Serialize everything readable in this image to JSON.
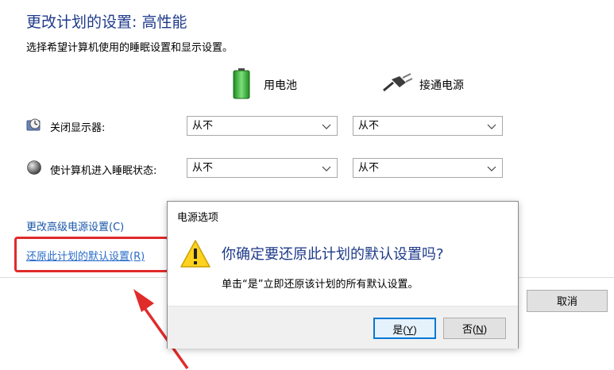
{
  "header": {
    "title": "更改计划的设置: 高性能",
    "subtitle": "选择希望计算机使用的睡眠设置和显示设置。"
  },
  "columns": {
    "battery": "用电池",
    "plugged_in": "接通电源"
  },
  "settings": [
    {
      "label": "关闭显示器:",
      "battery_value": "从不",
      "plugged_value": "从不",
      "icon": "monitor-clock-icon"
    },
    {
      "label": "使计算机进入睡眠状态:",
      "battery_value": "从不",
      "plugged_value": "从不",
      "icon": "moon-sleep-icon"
    }
  ],
  "links": {
    "advanced": "更改高级电源设置(C)",
    "restore": "还原此计划的默认设置(R)"
  },
  "buttons": {
    "cancel": "取消"
  },
  "dialog": {
    "title": "电源选项",
    "heading": "你确定要还原此计划的默认设置吗?",
    "message": "单击“是”立即还原该计划的所有默认设置。",
    "yes_label": "是(",
    "yes_key": "Y",
    "yes_suffix": ")",
    "no_label": "否(",
    "no_key": "N",
    "no_suffix": ")"
  },
  "colors": {
    "title_blue": "#1e3a8a",
    "link_blue": "#1a56a8",
    "highlight_red": "#e02b2b",
    "focus_blue": "#0078d7"
  }
}
